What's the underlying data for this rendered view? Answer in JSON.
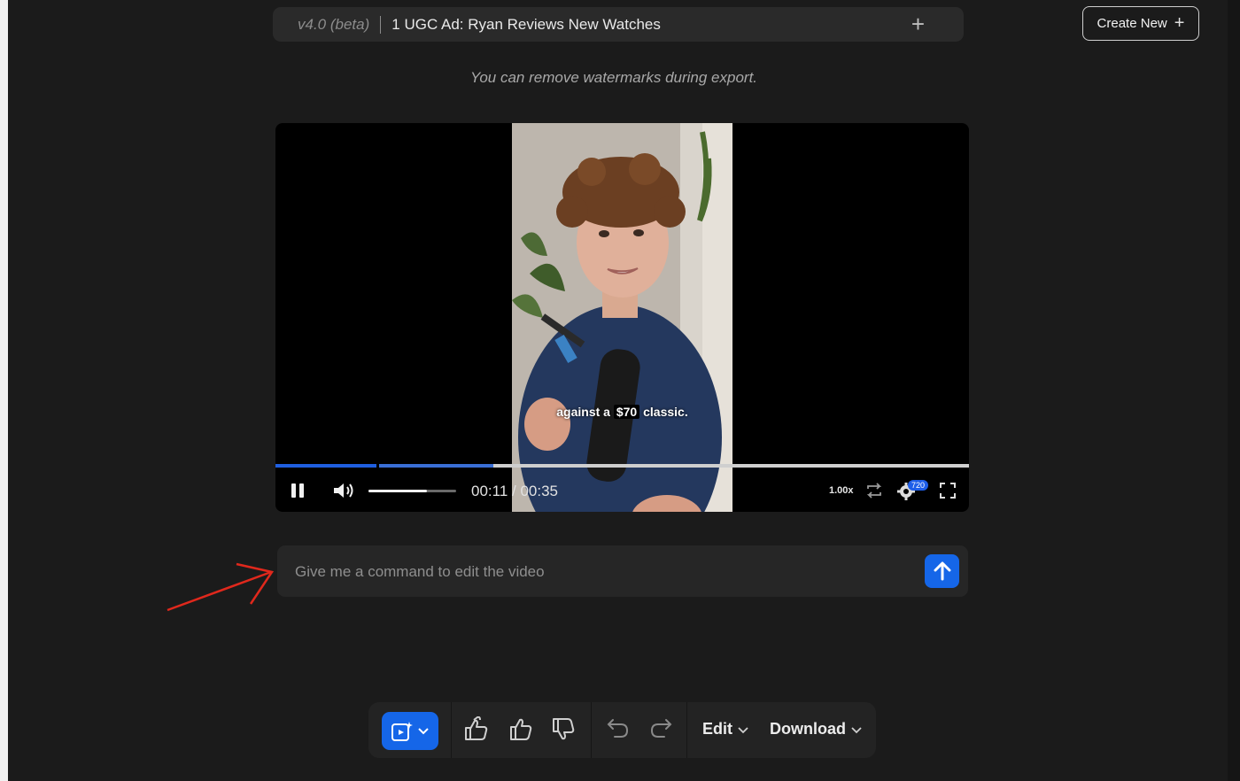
{
  "header": {
    "version": "v4.0 (beta)",
    "project_title": "1 UGC Ad: Ryan Reviews New Watches",
    "add_tab_icon": "plus-icon",
    "create_new_label": "Create New"
  },
  "notice": "You can remove watermarks during export.",
  "player": {
    "caption_before": "against a",
    "caption_highlight": "$70",
    "caption_after": "classic.",
    "time_display": "00:11 / 00:35",
    "speed": "1.00x",
    "quality": "720",
    "progress_fraction": 0.314,
    "buffered_fraction": 0.294,
    "volume_fraction": 0.67,
    "state": "playing",
    "icons": [
      "pause-icon",
      "volume-icon",
      "loop-icon",
      "settings-gear-icon",
      "fullscreen-icon"
    ]
  },
  "command": {
    "placeholder": "Give me a command to edit the video",
    "value": "",
    "send_icon": "arrow-up-icon"
  },
  "toolbar": {
    "clip_icon": "magic-clip-icon",
    "feedback_icons": [
      "thumbs-up-double-icon",
      "thumbs-up-icon",
      "thumbs-down-icon"
    ],
    "history_icons": [
      "undo-icon",
      "redo-icon"
    ],
    "edit_label": "Edit",
    "download_label": "Download"
  },
  "colors": {
    "accent": "#1566e8",
    "background": "#1b1b1b",
    "panel": "#262626",
    "annotation_arrow": "#e0281c"
  }
}
